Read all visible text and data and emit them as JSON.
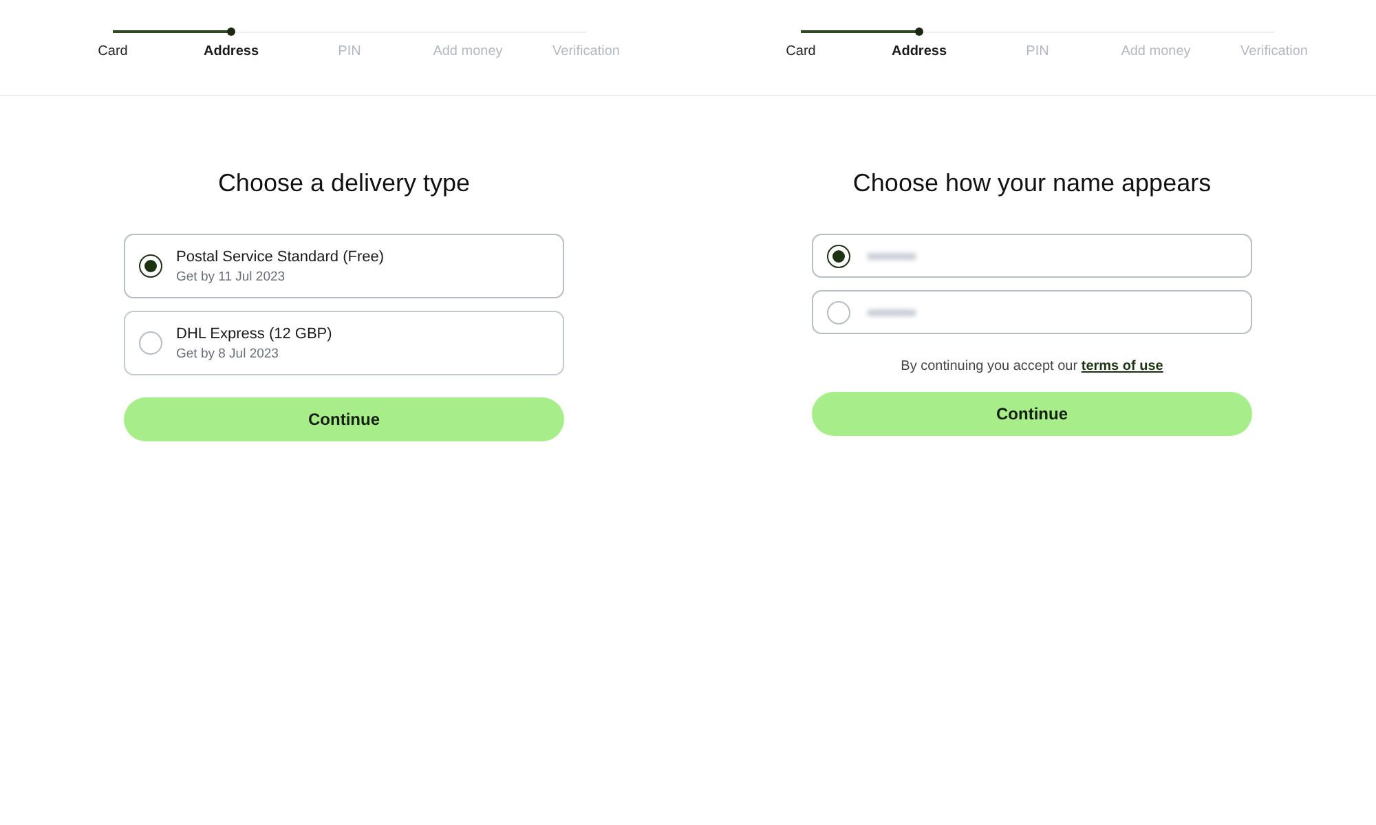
{
  "panels": [
    {
      "steps": [
        {
          "label": "Card",
          "selected": false
        },
        {
          "label": "Address",
          "selected": true
        },
        {
          "label": "PIN",
          "selected": false
        },
        {
          "label": "Add money",
          "selected": false
        },
        {
          "label": "Verification",
          "selected": false
        }
      ],
      "title": "Choose a delivery type",
      "options": [
        {
          "kind": "text",
          "label": "Postal Service Standard (Free)",
          "sublabel": "Get by 11 Jul 2023",
          "selected": true
        },
        {
          "kind": "text",
          "label": "DHL Express (12 GBP)",
          "sublabel": "Get by 8 Jul 2023",
          "selected": false
        }
      ],
      "button": "Continue"
    },
    {
      "steps": [
        {
          "label": "Card",
          "selected": false
        },
        {
          "label": "Address",
          "selected": true
        },
        {
          "label": "PIN",
          "selected": false
        },
        {
          "label": "Add money",
          "selected": false
        },
        {
          "label": "Verification",
          "selected": false
        }
      ],
      "title": "Choose how your name appears",
      "options": [
        {
          "kind": "blurred",
          "selected": true
        },
        {
          "kind": "blurred",
          "selected": false
        }
      ],
      "notice": {
        "text": "By continuing you accept our",
        "link": "terms of use"
      },
      "button": "Continue"
    }
  ]
}
